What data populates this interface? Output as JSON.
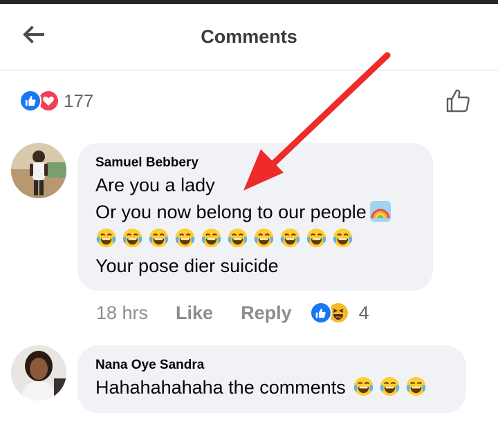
{
  "header": {
    "title": "Comments",
    "back_icon": "arrow-left-icon"
  },
  "post_reactions": {
    "types": [
      "like",
      "love"
    ],
    "count": "177"
  },
  "comments": [
    {
      "author": "Samuel Bebbery",
      "lines": [
        "Are you a lady",
        "Or you now belong to our people"
      ],
      "emoji_line_count": 10,
      "last_line": "Your pose dier suicide",
      "time": "18 hrs",
      "like_label": "Like",
      "reply_label": "Reply",
      "reaction_types": [
        "like",
        "haha"
      ],
      "reaction_count": "4"
    },
    {
      "author": "Nana Oye Sandra",
      "text": "Hahahahahaha the comments",
      "emoji_count": 3
    }
  ],
  "colors": {
    "like_blue": "#1877f2",
    "love_red": "#f33e58",
    "bubble_bg": "#f0f2f5",
    "annotation_arrow": "#ee2a2a"
  }
}
